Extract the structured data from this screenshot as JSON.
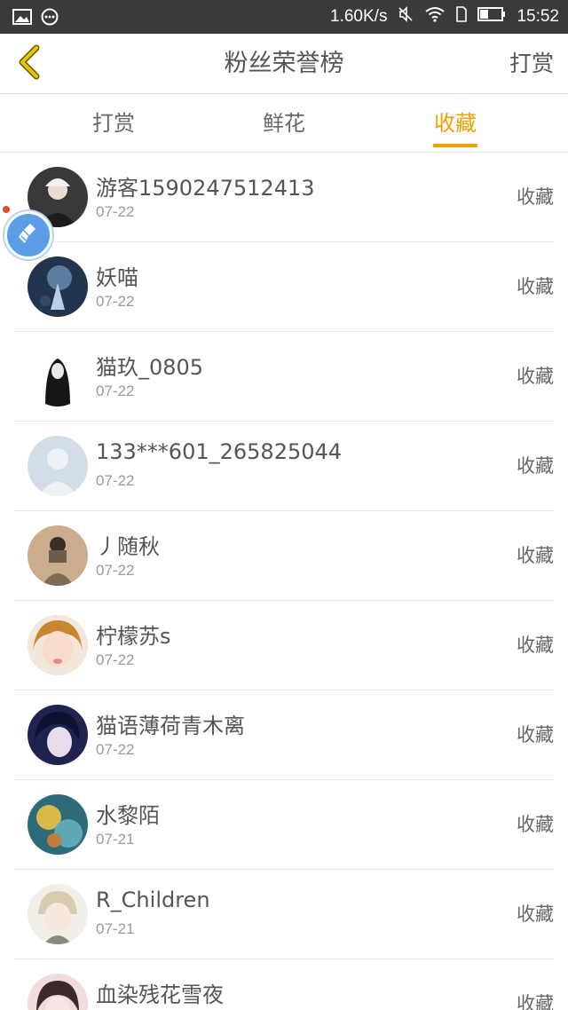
{
  "status_bar": {
    "left_icons": [
      "image-icon",
      "more-dots-icon"
    ],
    "speed": "1.60K/s",
    "time": "15:52"
  },
  "header": {
    "title": "粉丝荣誉榜",
    "action_label": "打赏"
  },
  "tabs": [
    {
      "label": "打赏",
      "active": false
    },
    {
      "label": "鲜花",
      "active": false
    },
    {
      "label": "收藏",
      "active": true
    }
  ],
  "fans": [
    {
      "name": "游客1590247512413",
      "date": "07-22",
      "action": "收藏"
    },
    {
      "name": "妖喵",
      "date": "07-22",
      "action": "收藏"
    },
    {
      "name": "猫玖_0805",
      "date": "07-22",
      "action": "收藏"
    },
    {
      "name": "133***601_265825044",
      "date": "07-22",
      "action": "收藏"
    },
    {
      "name": "丿随秋",
      "date": "07-22",
      "action": "收藏"
    },
    {
      "name": "柠檬苏s",
      "date": "07-22",
      "action": "收藏"
    },
    {
      "name": "猫语薄荷青木离",
      "date": "07-22",
      "action": "收藏"
    },
    {
      "name": "水黎陌",
      "date": "07-21",
      "action": "收藏"
    },
    {
      "name": "R_Children",
      "date": "07-21",
      "action": "收藏"
    },
    {
      "name": "血染残花雪夜",
      "date": "",
      "action": "收藏"
    }
  ],
  "colors": {
    "accent": "#f0a000",
    "status_bar": "#3a3a3a",
    "back_arrow": "#e6b800",
    "bubble": "#5b9ee6"
  }
}
